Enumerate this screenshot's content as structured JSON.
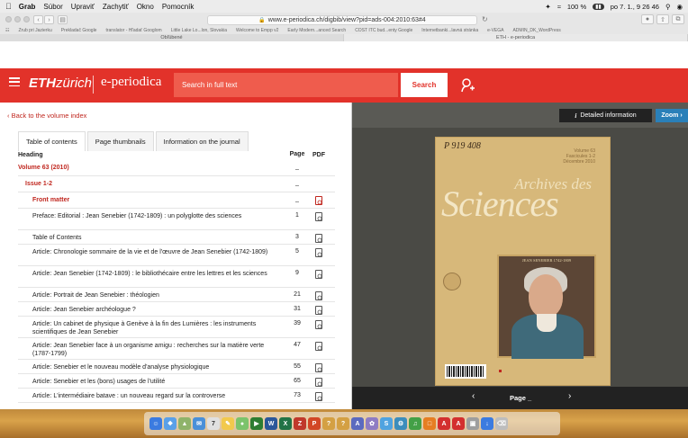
{
  "menubar": {
    "app": "Grab",
    "items": [
      "Súbor",
      "Upraviť",
      "Zachytiť",
      "Okno",
      "Pomocník"
    ],
    "battery": "100 %",
    "clock": "po 7. 1.,  9 26 46"
  },
  "browser": {
    "url": "www.e-periodica.ch/digbib/view?pid=ads-004:2010:63#4",
    "bookmarks": [
      "Zrub pri Jazierku",
      "Prekladač Google",
      "translator - Hľadať Googlom",
      "Little Lake Lo...lon, Slovakia",
      "Welcome to Empp v2",
      "Early Modern...anced Search",
      "COST ITC bud...enty Google",
      "Internetbanki...lavná stránka",
      "e-VEGA",
      "ADMIN_DK_WordPress"
    ],
    "tabs": [
      "Obľúbené",
      "ETH - e-periodica"
    ]
  },
  "header": {
    "brand_bold": "ETH",
    "brand_light": "zürich",
    "site": "e-periodica",
    "search_placeholder": "Search in full text",
    "search_button": "Search"
  },
  "left": {
    "back": "Back to the volume index",
    "tabs": [
      "Table of contents",
      "Page thumbnails",
      "Information on the journal"
    ],
    "columns": {
      "heading": "Heading",
      "page": "Page",
      "pdf": "PDF"
    },
    "rows": [
      {
        "title": "Volume 63 (2010)",
        "page": "_",
        "pdf": false,
        "style": "volume"
      },
      {
        "title": "Issue 1-2",
        "page": "_",
        "pdf": false,
        "style": "issue"
      },
      {
        "title": "Front matter",
        "page": "_",
        "pdf": true,
        "style": "front"
      },
      {
        "title": "Preface: Editorial : Jean Senebier (1742-1809) : un polyglotte des sciences",
        "page": "1",
        "pdf": true,
        "style": "article"
      },
      {
        "title": "Table of Contents",
        "page": "3",
        "pdf": true,
        "style": "article"
      },
      {
        "title": "Article: Chronologie sommaire de la vie et de l'œuvre de Jean Senebier (1742-1809)",
        "page": "5",
        "pdf": true,
        "style": "article"
      },
      {
        "title": "Article: Jean Senebier (1742-1809) : le bibliothécaire entre les lettres et les sciences",
        "page": "9",
        "pdf": true,
        "style": "article"
      },
      {
        "title": "Article: Portrait de Jean Senebier : théologien",
        "page": "21",
        "pdf": true,
        "style": "article"
      },
      {
        "title": "Article: Jean Senebier archéologue ?",
        "page": "31",
        "pdf": true,
        "style": "article"
      },
      {
        "title": "Article: Un cabinet de physique à Genève à la fin des Lumières : les instruments scientifiques de Jean Senebier",
        "page": "39",
        "pdf": true,
        "style": "article"
      },
      {
        "title": "Article: Jean Senebier face à un organisme amigu : recherches sur la matière verte (1787-1799)",
        "page": "47",
        "pdf": true,
        "style": "article"
      },
      {
        "title": "Article: Senebier et le nouveau modèle d'analyse physiologique",
        "page": "55",
        "pdf": true,
        "style": "article"
      },
      {
        "title": "Article: Senebier et les (bons) usages de l'utilité",
        "page": "65",
        "pdf": true,
        "style": "article"
      },
      {
        "title": "Article: L'intermédiaire batave : un nouveau regard sur la controverse",
        "page": "73",
        "pdf": true,
        "style": "article"
      }
    ]
  },
  "right": {
    "detail_button": "Detailed information",
    "detail_icon": "i",
    "zoom_button": "Zoom",
    "cover": {
      "handwritten": "P 919 408",
      "volume_line1": "Volume 63",
      "volume_line2": "Fascicules 1-2",
      "date": "Décembre 2010",
      "title_top": "Archives des",
      "title_main": "Sciences",
      "portrait_caption": "JEAN SENEBIER 1742-1809"
    },
    "pager_label": "Page _"
  }
}
